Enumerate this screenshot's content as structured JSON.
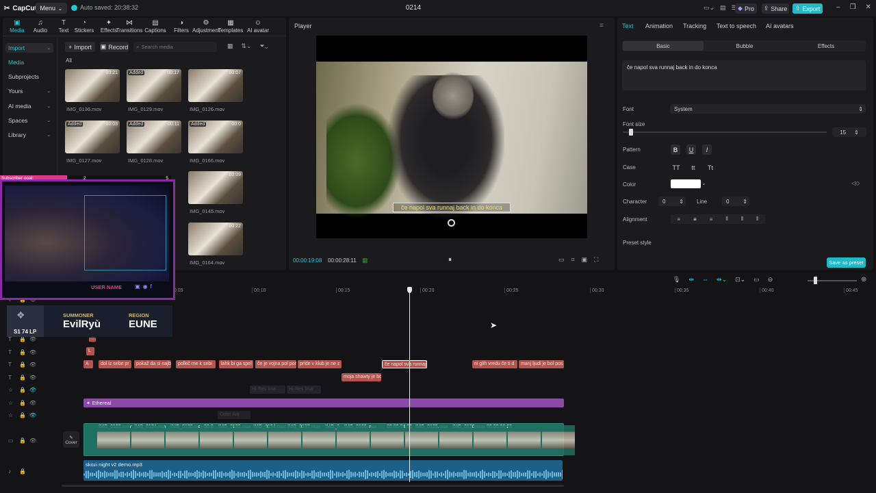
{
  "app": {
    "logo": "CapCut",
    "menu": "Menu",
    "autosave": "Auto saved: 20:38:32",
    "project": "0214",
    "pro": "Pro",
    "share": "Share",
    "export": "Export"
  },
  "toolbar": {
    "tabs": [
      {
        "label": "Media",
        "icon": "media-icon"
      },
      {
        "label": "Audio",
        "icon": "audio-icon"
      },
      {
        "label": "Text",
        "icon": "text-icon"
      },
      {
        "label": "Stickers",
        "icon": "stickers-icon"
      },
      {
        "label": "Effects",
        "icon": "effects-icon"
      },
      {
        "label": "Transitions",
        "icon": "transitions-icon"
      },
      {
        "label": "Captions",
        "icon": "captions-icon"
      },
      {
        "label": "Filters",
        "icon": "filters-icon"
      },
      {
        "label": "Adjustment",
        "icon": "adjustment-icon"
      },
      {
        "label": "Templates",
        "icon": "templates-icon"
      },
      {
        "label": "AI avatar",
        "icon": "ai-avatar-icon"
      }
    ]
  },
  "sidebar": {
    "items": [
      "Import",
      "Media",
      "Subprojects",
      "Yours",
      "AI media",
      "Spaces",
      "Library"
    ]
  },
  "media": {
    "import_btn": "Import",
    "record_btn": "Record",
    "search_placeholder": "Search media",
    "filter_all": "All",
    "items": [
      {
        "name": "IMG_0136.mov",
        "badge": "",
        "dur": "00:21"
      },
      {
        "name": "IMG_0129.mov",
        "badge": "Added",
        "dur": "00:17"
      },
      {
        "name": "IMG_0126.mov",
        "badge": "",
        "dur": "00:07"
      },
      {
        "name": "IMG_0127.mov",
        "badge": "Added",
        "dur": "00:03"
      },
      {
        "name": "IMG_0128.mov",
        "badge": "Added",
        "dur": "00:11"
      },
      {
        "name": "IMG_0166.mov",
        "badge": "Added",
        "dur": "00:0"
      },
      {
        "name": "IMG_0145.mov",
        "badge": "",
        "dur": "00:09"
      },
      {
        "name": "IMG_0164.mov",
        "badge": "",
        "dur": "00:22"
      }
    ]
  },
  "overlay": {
    "sub_goal": "Subscriber goal:",
    "goal_left": "2",
    "goal_right": "5",
    "username": "USER NAME",
    "summoner_label": "SUMMONER",
    "summoner": "EvilRyù",
    "region_label": "REGION",
    "region": "EUNE",
    "rank": "S1 74 LP"
  },
  "player": {
    "title": "Player",
    "subtitle": "če napol sva runnaj back in do konca",
    "time_current": "00:00:19:08",
    "time_total": "00:00:28:11"
  },
  "props": {
    "tabs": [
      "Text",
      "Animation",
      "Tracking",
      "Text to speech",
      "AI avatars"
    ],
    "subtabs": [
      "Basic",
      "Bubble",
      "Effects"
    ],
    "text_value": "če napol sva runnaj back in do konca",
    "font_label": "Font",
    "font_value": "System",
    "font_size_label": "Font size",
    "font_size": "15",
    "pattern_label": "Pattern",
    "case_label": "Case",
    "color_label": "Color",
    "character_label": "Character",
    "character": "0",
    "line_label": "Line",
    "line": "0",
    "alignment_label": "Alignment",
    "preset_label": "Preset style",
    "save_preset": "Save as preset",
    "pattern_btns": [
      "B",
      "U",
      "I"
    ],
    "case_btns": [
      "TT",
      "tt",
      "Tt"
    ]
  },
  "timeline": {
    "ruler": [
      "00:05",
      "00:10",
      "00:15",
      "00:20",
      "00:25",
      "00:30",
      "00:35",
      "00:40",
      "00:45"
    ],
    "text_clips": [
      "A",
      "dol iz sebe pr",
      "pokaž da si najb",
      "polkič me k sebi",
      "lahk bi ga spel",
      "če je vojna pol por",
      "pride v klub je ne z",
      "če napol sva runnaj",
      "ni glih vredu če ti d",
      "manj ljudi je bol pos"
    ],
    "text_clips2": [
      "moja shawty je bo"
    ],
    "ghost_clips": [
      "Hi-Res Ima",
      "Hi-Res Ima",
      "Color Adj"
    ],
    "effect_clip": "Ethereal",
    "video_clips": [
      "IMG_0162.mov",
      "IMG_0134.mov",
      "IMG_0130.mov",
      "00:0",
      "IMG_0132.mov",
      "IMG_0134.mov",
      "IMG_0137.mov",
      "IMG_0",
      "IMG_0166.mov",
      "00:00:04:03",
      "IMG_0129.mov",
      "IMG_0120.mov",
      "00:00:06:23"
    ],
    "cover": "Cover",
    "audio_clip": "skozi night v2 demo.mp3",
    "small_clips": [
      "L"
    ]
  },
  "colors": {
    "accent": "#25c4d4",
    "text_clip": "#b4544f",
    "effect": "#8a4aa8",
    "video": "#1f6f62",
    "audio": "#1d5f86"
  }
}
